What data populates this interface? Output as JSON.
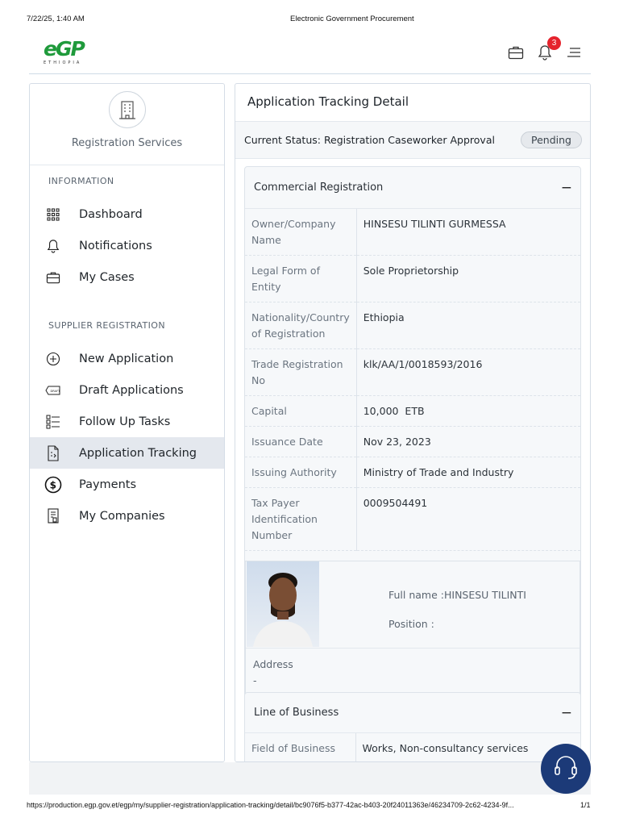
{
  "print": {
    "timestamp": "7/22/25, 1:40 AM",
    "page_title": "Electronic Government Procurement",
    "url": "https://production.egp.gov.et/egp/my/supplier-registration/application-tracking/detail/bc9076f5-b377-42ac-b403-20f24011363e/46234709-2c62-4234-9f...",
    "page_number": "1/1"
  },
  "logo": {
    "mark": "eGP",
    "sub": "ETHIOPIA"
  },
  "header": {
    "notification_count": "3"
  },
  "sidebar": {
    "title": "Registration Services",
    "section_information": "INFORMATION",
    "section_supplier": "SUPPLIER REGISTRATION",
    "items": [
      {
        "label": "Dashboard",
        "icon": "grid-icon"
      },
      {
        "label": "Notifications",
        "icon": "bell-icon"
      },
      {
        "label": "My Cases",
        "icon": "briefcase-icon"
      },
      {
        "label": "New Application",
        "icon": "plus-circle-icon"
      },
      {
        "label": "Draft Applications",
        "icon": "draft-icon"
      },
      {
        "label": "Follow Up Tasks",
        "icon": "task-list-icon"
      },
      {
        "label": "Application Tracking",
        "icon": "tracking-icon"
      },
      {
        "label": "Payments",
        "icon": "dollar-icon"
      },
      {
        "label": "My Companies",
        "icon": "company-doc-icon"
      }
    ]
  },
  "main": {
    "title": "Application Tracking Detail",
    "status_label": "Current Status: Registration Caseworker Approval",
    "status_badge": "Pending",
    "commercial": {
      "title": "Commercial Registration",
      "rows": [
        {
          "k": "Owner/Company Name",
          "v": "HINSESU TILINTI GURMESSA"
        },
        {
          "k": "Legal Form of Entity",
          "v": "Sole Proprietorship"
        },
        {
          "k": "Nationality/Country of Registration",
          "v": "Ethiopia"
        },
        {
          "k": "Trade Registration No",
          "v": "klk/AA/1/0018593/2016"
        },
        {
          "k": "Capital",
          "v": "10,000  ETB"
        },
        {
          "k": "Issuance Date",
          "v": "Nov 23, 2023"
        },
        {
          "k": "Issuing Authority",
          "v": "Ministry of Trade and Industry"
        },
        {
          "k": "Tax Payer Identification Number",
          "v": "0009504491"
        }
      ],
      "person": {
        "full_name": "Full name :HINSESU TILINTI",
        "position": "Position :",
        "address_label": "Address",
        "address_value": "-"
      }
    },
    "line_of_business": {
      "title": "Line of Business",
      "row_k": "Field of Business",
      "row_v": "Works, Non-consultancy services"
    }
  }
}
